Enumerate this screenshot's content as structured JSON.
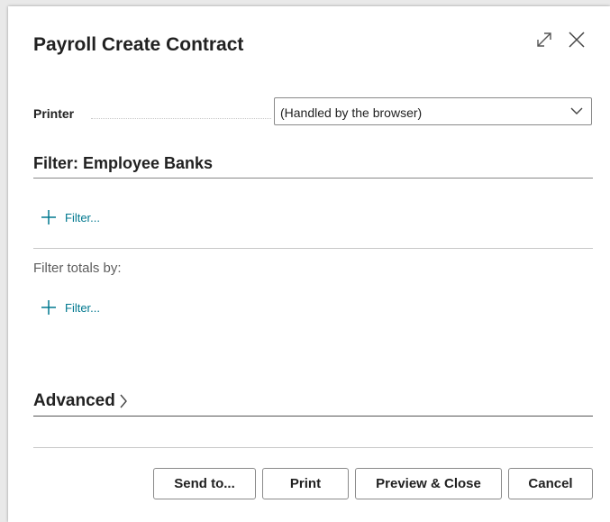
{
  "dialog": {
    "title": "Payroll Create Contract",
    "expand_icon": "expand-icon",
    "close_icon": "close-icon"
  },
  "printer": {
    "label": "Printer",
    "value": "(Handled by the browser)"
  },
  "filter_section": {
    "title": "Filter: Employee Banks",
    "add_filter_label": "Filter..."
  },
  "totals_section": {
    "label": "Filter totals by:",
    "add_filter_label": "Filter..."
  },
  "advanced": {
    "label": "Advanced"
  },
  "buttons": {
    "send_to": "Send to...",
    "print": "Print",
    "preview_close": "Preview & Close",
    "cancel": "Cancel"
  },
  "colors": {
    "accent": "#00788f",
    "text": "#212121",
    "muted": "#5e5e5e",
    "divider": "#c8c8c8"
  }
}
